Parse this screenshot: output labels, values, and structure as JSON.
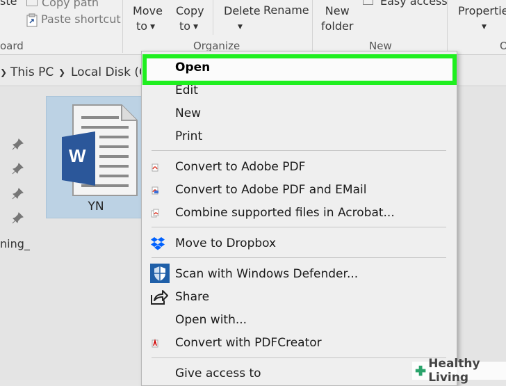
{
  "ribbon": {
    "clipboard_cut": "ste",
    "copy_path": "Copy path",
    "paste_shortcut": "Paste shortcut",
    "clipboard_label": "oard",
    "move_to_1": "Move",
    "move_to_2": "to",
    "copy_to_1": "Copy",
    "copy_to_2": "to",
    "delete": "Delete",
    "rename": "Rename",
    "organize_label": "Organize",
    "new_folder_1": "New",
    "new_folder_2": "folder",
    "easy_access": "Easy access",
    "new_label": "New",
    "properties": "Properties",
    "open_label": "O"
  },
  "address": {
    "this_pc": "This PC",
    "local_disk": "Local Disk (C"
  },
  "nav": {
    "truncated_item": "ning_"
  },
  "file": {
    "name": "YN",
    "app_letter": "W"
  },
  "menu": {
    "items": [
      "Open",
      "Edit",
      "New",
      "Print",
      "Convert to Adobe PDF",
      "Convert to Adobe PDF and EMail",
      "Combine supported files in Acrobat...",
      "Move to Dropbox",
      "Scan with Windows Defender...",
      "Share",
      "Open with...",
      "Convert with PDFCreator",
      "Give access to"
    ]
  },
  "watermark": {
    "text": "Healthy Living"
  },
  "colors": {
    "highlight": "#1fef1f",
    "word_blue": "#2b579a",
    "selection": "#bcd2e4",
    "dropbox": "#0061fe"
  }
}
